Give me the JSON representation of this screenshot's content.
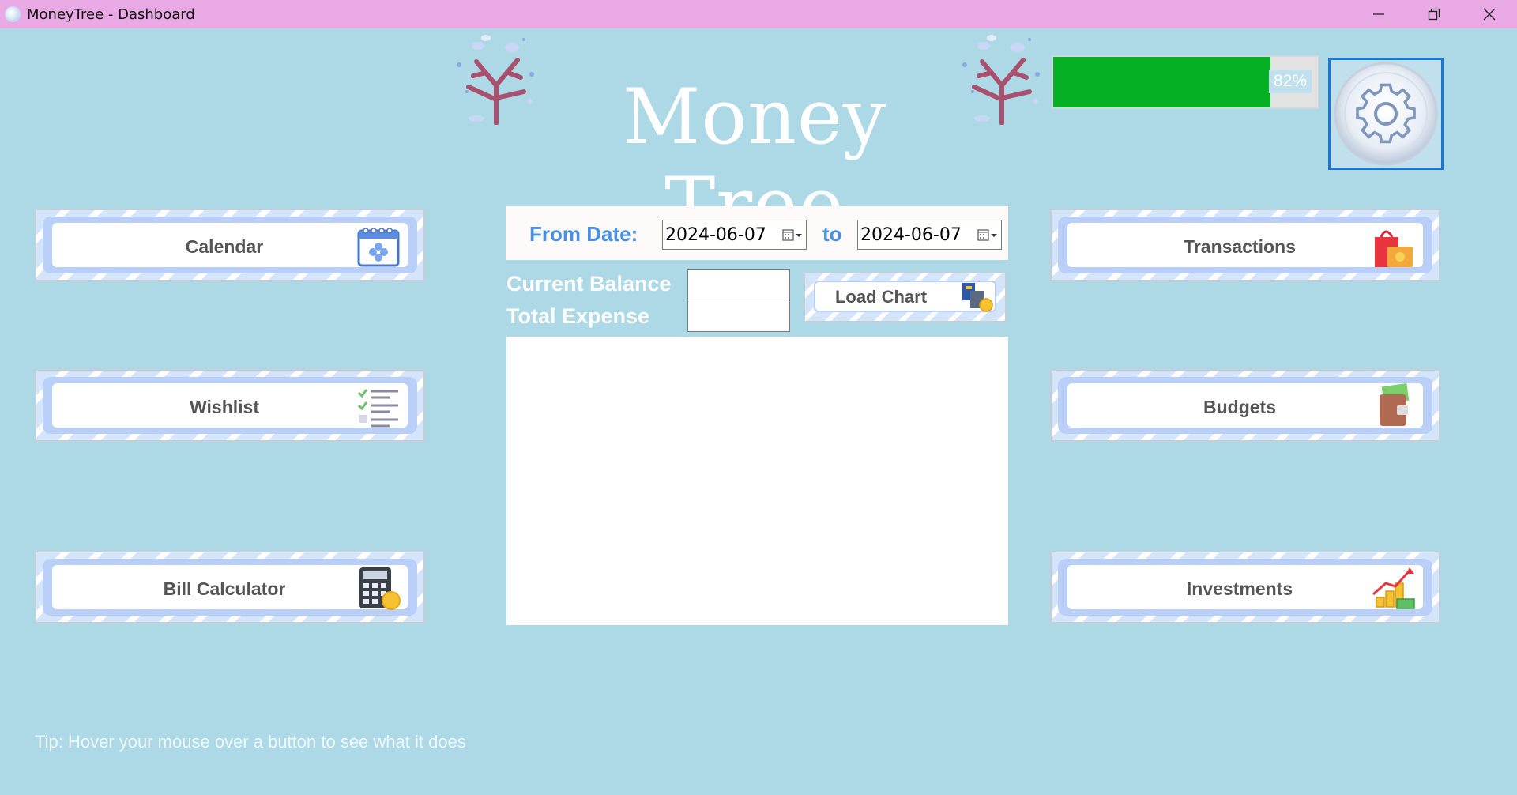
{
  "window": {
    "title": "MoneyTree - Dashboard",
    "controls": [
      "minimize",
      "restore",
      "close"
    ]
  },
  "header": {
    "logo_text": "Money Tree",
    "progress_value": 0.82,
    "progress_label": "82%",
    "progress_color": "#06b025"
  },
  "nav_left": [
    {
      "label": "Calendar",
      "icon": "calendar-icon"
    },
    {
      "label": "Wishlist",
      "icon": "checklist-icon"
    },
    {
      "label": "Bill Calculator",
      "icon": "calculator-icon"
    }
  ],
  "nav_right": [
    {
      "label": "Transactions",
      "icon": "shopping-bag-icon"
    },
    {
      "label": "Budgets",
      "icon": "wallet-icon"
    },
    {
      "label": "Investments",
      "icon": "money-growth-icon"
    }
  ],
  "filters": {
    "from_label": "From Date:",
    "from_value": "2024-06-07",
    "to_label": "to",
    "to_value": "2024-06-07"
  },
  "summary": {
    "balance_label": "Current Balance",
    "balance_value": "",
    "expense_label": "Total Expense",
    "expense_value": ""
  },
  "chart": {
    "load_label": "Load Chart"
  },
  "footer": {
    "tip": "Tip: Hover your mouse over a button to see what it does"
  }
}
